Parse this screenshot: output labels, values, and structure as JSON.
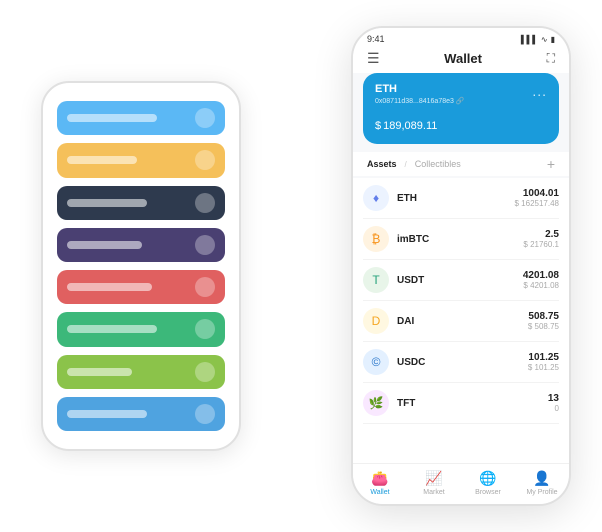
{
  "bg_phone": {
    "cards": [
      {
        "color": "#5bb8f5",
        "label_width": "90px"
      },
      {
        "color": "#f5c05a",
        "label_width": "70px"
      },
      {
        "color": "#2e3a4e",
        "label_width": "80px"
      },
      {
        "color": "#4a4072",
        "label_width": "75px"
      },
      {
        "color": "#e06060",
        "label_width": "85px"
      },
      {
        "color": "#3cb87a",
        "label_width": "90px"
      },
      {
        "color": "#8bc34a",
        "label_width": "65px"
      },
      {
        "color": "#4fa3e0",
        "label_width": "80px"
      }
    ]
  },
  "phone": {
    "status_bar": {
      "time": "9:41",
      "signal": "▌▌▌",
      "wifi": "WiFi",
      "battery": "🔋"
    },
    "header": {
      "menu_icon": "☰",
      "title": "Wallet",
      "expand_icon": "⛶"
    },
    "eth_card": {
      "title": "ETH",
      "address": "0x08711d38...8416a78e3 🔗",
      "dollar_sign": "$",
      "amount": "189,089.11",
      "more": "..."
    },
    "assets_section": {
      "active_tab": "Assets",
      "separator": "/",
      "inactive_tab": "Collectibles",
      "add_button": "+"
    },
    "assets": [
      {
        "name": "ETH",
        "icon_char": "♦",
        "icon_bg": "#ecf3ff",
        "icon_color": "#627eea",
        "amount": "1004.01",
        "usd": "$ 162517.48"
      },
      {
        "name": "imBTC",
        "icon_char": "₿",
        "icon_bg": "#fff3e0",
        "icon_color": "#f7931a",
        "amount": "2.5",
        "usd": "$ 21760.1"
      },
      {
        "name": "USDT",
        "icon_char": "T",
        "icon_bg": "#e8f5e9",
        "icon_color": "#26a17b",
        "amount": "4201.08",
        "usd": "$ 4201.08"
      },
      {
        "name": "DAI",
        "icon_char": "D",
        "icon_bg": "#fff8e1",
        "icon_color": "#f5a623",
        "amount": "508.75",
        "usd": "$ 508.75"
      },
      {
        "name": "USDC",
        "icon_char": "©",
        "icon_bg": "#e3f0ff",
        "icon_color": "#2775ca",
        "amount": "101.25",
        "usd": "$ 101.25"
      },
      {
        "name": "TFT",
        "icon_char": "🌿",
        "icon_bg": "#f9e8ff",
        "icon_color": "#9c27b0",
        "amount": "13",
        "usd": "0"
      }
    ],
    "nav": [
      {
        "icon": "👛",
        "label": "Wallet",
        "active": true
      },
      {
        "icon": "📈",
        "label": "Market",
        "active": false
      },
      {
        "icon": "🌐",
        "label": "Browser",
        "active": false
      },
      {
        "icon": "👤",
        "label": "My Profile",
        "active": false
      }
    ]
  }
}
